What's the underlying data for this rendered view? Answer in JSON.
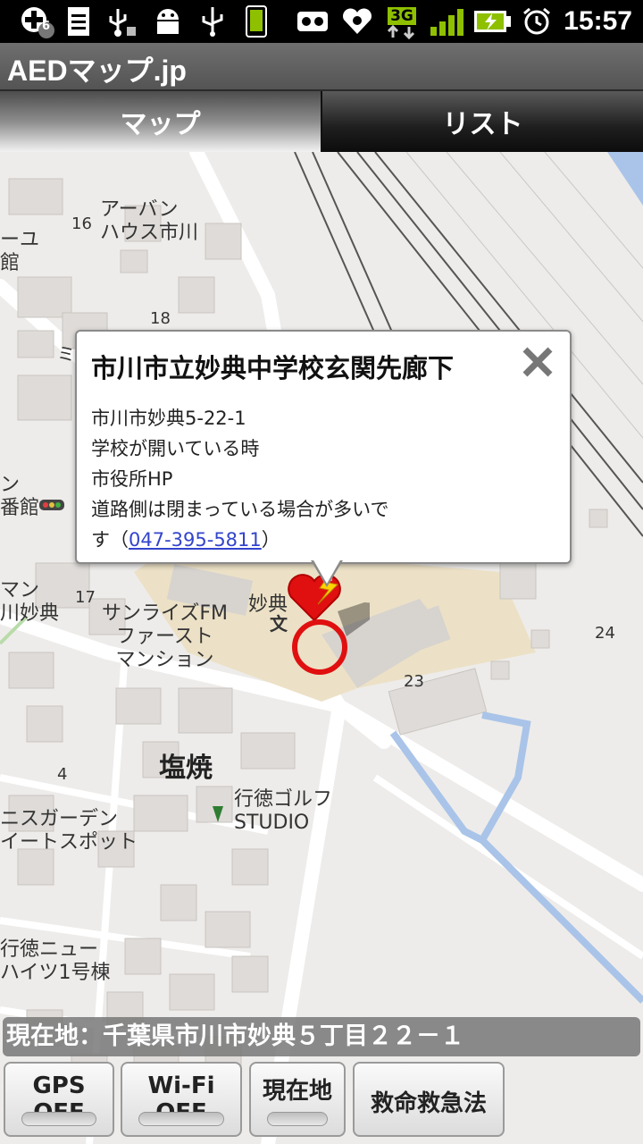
{
  "status_bar": {
    "time": "15:57",
    "notification_count": "6",
    "network": "3G"
  },
  "app": {
    "title": "AEDマップ.jp"
  },
  "tabs": [
    {
      "label": "マップ",
      "selected": true
    },
    {
      "label": "リスト",
      "selected": false
    }
  ],
  "map": {
    "labels": {
      "urban_house": "アーバン\nハウス市川",
      "num16": "16",
      "num18": "18",
      "num17": "17",
      "num4": "4",
      "num24": "24",
      "num23": "23",
      "myoden": "妙典",
      "school_mark": "文",
      "sunrise": "サンライズFM\nファースト\nマンション",
      "shiohama": "塩焼",
      "golf": "行徳ゴルフ\nSTUDIO",
      "garden": "ニスガーデン\nイートスポット",
      "gyotoku_new": "行徳ニュー\nハイツ1号棟",
      "left_frag_1": "ーユ\n館",
      "left_frag_2": "ミ",
      "left_frag_3": "ン\n番館",
      "left_frag_4": "マン\n川妙典"
    }
  },
  "popup": {
    "title": "市川市立妙典中学校玄関先廊下",
    "address": "市川市妙典5-22-1",
    "hours": "学校が開いている時",
    "source": "市役所HP",
    "note_line1": "道路側は閉まっている場合が多いで",
    "note_line2_prefix": "す（",
    "phone": "047-395-5811",
    "note_line2_suffix": "）"
  },
  "current_location": "現在地：千葉県市川市妙典５丁目２２－１",
  "buttons": {
    "gps": "GPS OFF",
    "wifi": "Wi-Fi OFF",
    "current": "現在地",
    "rescue": "救命救急法"
  }
}
